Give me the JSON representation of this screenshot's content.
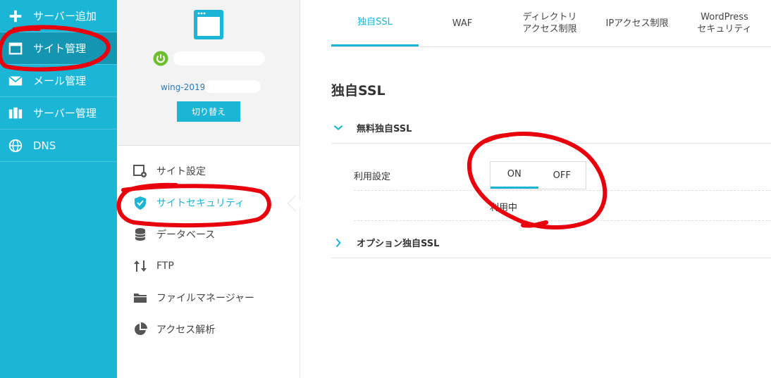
{
  "nav": {
    "items": [
      {
        "label": "サーバー追加",
        "icon": "plus-icon"
      },
      {
        "label": "サイト管理",
        "icon": "browser-window-icon"
      },
      {
        "label": "メール管理",
        "icon": "envelope-icon"
      },
      {
        "label": "サーバー管理",
        "icon": "server-icon"
      },
      {
        "label": "DNS",
        "icon": "globe-icon"
      }
    ]
  },
  "site": {
    "url_prefix": "wing-2019",
    "switch_label": "切り替え"
  },
  "menu": {
    "items": [
      {
        "label": "サイト設定",
        "icon": "site-settings-icon"
      },
      {
        "label": "サイトセキュリティ",
        "icon": "shield-check-icon"
      },
      {
        "label": "データベース",
        "icon": "database-icon"
      },
      {
        "label": "FTP",
        "icon": "transfer-arrows-icon"
      },
      {
        "label": "ファイルマネージャー",
        "icon": "folder-icon"
      },
      {
        "label": "アクセス解析",
        "icon": "pie-chart-icon"
      }
    ]
  },
  "tabs": [
    {
      "label": "独自SSL"
    },
    {
      "label": "WAF"
    },
    {
      "label": "ディレクトリ\nアクセス制限"
    },
    {
      "label": "IPアクセス制限"
    },
    {
      "label": "WordPress\nセキュリティ"
    }
  ],
  "content": {
    "title": "独自SSL",
    "free_ssl_label": "無料独自SSL",
    "usage_label": "利用設定",
    "toggle_on": "ON",
    "toggle_off": "OFF",
    "status": "利用中",
    "option_ssl_label": "オプション独自SSL"
  },
  "colors": {
    "accent": "#1bb5d6",
    "nav_active": "#1495b2",
    "annotation": "#e8000d"
  }
}
